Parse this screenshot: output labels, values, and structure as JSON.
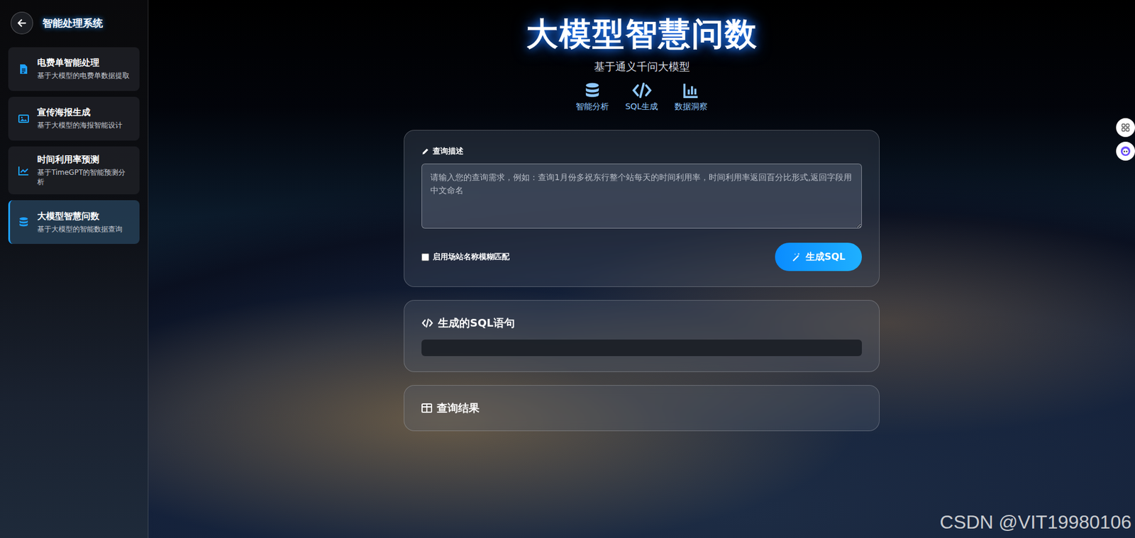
{
  "sidebar": {
    "title": "智能处理系统",
    "items": [
      {
        "title": "电费单智能处理",
        "subtitle": "基于大模型的电费单数据提取",
        "selected": false
      },
      {
        "title": "宣传海报生成",
        "subtitle": "基于大模型的海报智能设计",
        "selected": false
      },
      {
        "title": "时间利用率预测",
        "subtitle": "基于TimeGPT的智能预测分析",
        "selected": false
      },
      {
        "title": "大模型智慧问数",
        "subtitle": "基于大模型的智能数据查询",
        "selected": true
      }
    ]
  },
  "header": {
    "title": "大模型智慧问数",
    "subtitle": "基于通义千问大模型",
    "features": [
      {
        "label": "智能分析"
      },
      {
        "label": "SQL生成"
      },
      {
        "label": "数据洞察"
      }
    ]
  },
  "query": {
    "label": "查询描述",
    "placeholder": "请输入您的查询需求，例如：查询1月份多祝东行整个站每天的时间利用率，时间利用率返回百分比形式,返回字段用中文命名",
    "value": "",
    "fuzzy_match": {
      "label": "启用场站名称模糊匹配",
      "checked": false
    },
    "button": "生成SQL"
  },
  "sql_panel": {
    "title": "生成的SQL语句",
    "sql": ""
  },
  "result_panel": {
    "title": "查询结果"
  },
  "watermark": "CSDN @VIT19980106"
}
